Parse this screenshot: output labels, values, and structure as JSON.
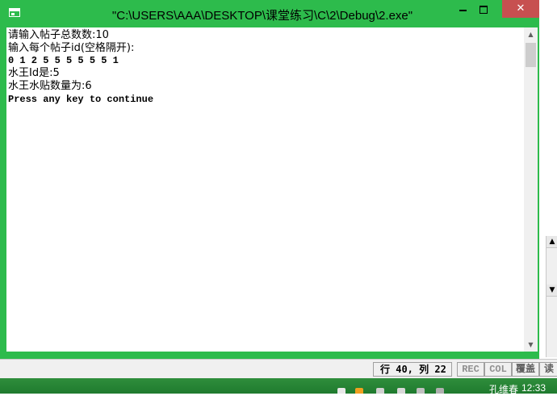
{
  "window": {
    "title": "\"C:\\USERS\\AAA\\DESKTOP\\课堂练习\\C\\2\\Debug\\2.exe\"",
    "close_glyph": "✕",
    "icon": "console-window-icon"
  },
  "console": {
    "lines": [
      "请输入帖子总数数:10",
      "输入每个帖子id(空格隔开):",
      "0 1 2 5 5 5 5 5 5 1",
      "水王Id是:5",
      "水王水贴数量为:6",
      "Press any key to continue"
    ]
  },
  "scrollbar": {
    "up": "▲",
    "down": "▼"
  },
  "background_editor": {
    "scroll_up": "▲",
    "scroll_down": "▼"
  },
  "statusbar": {
    "position": "行 40, 列 22",
    "rec": "REC",
    "col": "COL",
    "ovr": "覆盖",
    "read": "读"
  },
  "taskbar": {
    "user": "孔维春",
    "time": "12:33"
  },
  "colors": {
    "window_frame": "#2dbb4c",
    "close_button": "#c75050",
    "taskbar": "#2f8e3c"
  }
}
